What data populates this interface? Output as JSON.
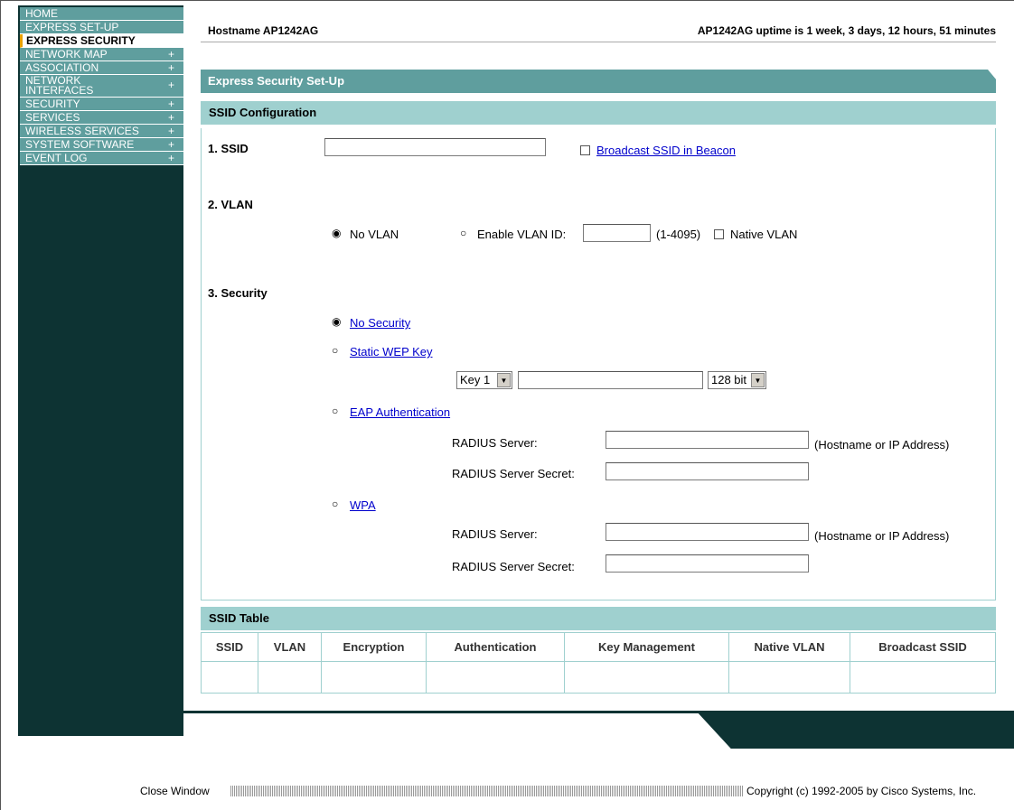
{
  "nav": [
    {
      "label": "HOME",
      "plus": ""
    },
    {
      "label": "EXPRESS SET-UP",
      "plus": ""
    },
    {
      "label": "EXPRESS SECURITY",
      "plus": ""
    },
    {
      "label": "NETWORK MAP",
      "plus": "+"
    },
    {
      "label": "ASSOCIATION",
      "plus": "+"
    },
    {
      "label": "NETWORK\nINTERFACES",
      "plus": "+"
    },
    {
      "label": "SECURITY",
      "plus": "+"
    },
    {
      "label": "SERVICES",
      "plus": "+"
    },
    {
      "label": "WIRELESS SERVICES",
      "plus": "+"
    },
    {
      "label": "SYSTEM SOFTWARE",
      "plus": "+"
    },
    {
      "label": "EVENT LOG",
      "plus": "+"
    }
  ],
  "header": {
    "hostname": "Hostname  AP1242AG",
    "uptime": "AP1242AG uptime is 1 week, 3 days, 12 hours, 51 minutes"
  },
  "panel": {
    "title": "Express Security Set-Up",
    "ssid_config": "SSID Configuration",
    "ssid_label": "1. SSID",
    "ssid_value": "",
    "broadcast_label": "Broadcast SSID in Beacon",
    "vlan_label": "2. VLAN",
    "no_vlan": "No VLAN",
    "enable_vlan": "Enable VLAN ID:",
    "vlan_range": "(1-4095)",
    "native_vlan": "Native VLAN",
    "security_label": "3. Security",
    "no_security": "No Security",
    "static_wep": "Static WEP Key",
    "key_select": "Key 1",
    "key_size": "128 bit",
    "eap_auth": "EAP Authentication",
    "radius_server": "RADIUS Server:",
    "radius_secret": "RADIUS Server Secret:",
    "hostname_hint": "(Hostname or IP Address)",
    "wpa": "WPA"
  },
  "ssid_table": {
    "title": "SSID Table",
    "headers": [
      "SSID",
      "VLAN",
      "Encryption",
      "Authentication",
      "Key Management",
      "Native VLAN",
      "Broadcast SSID"
    ]
  },
  "footer": {
    "close": "Close Window",
    "copyright": "Copyright (c) 1992-2005 by Cisco Systems, Inc."
  }
}
